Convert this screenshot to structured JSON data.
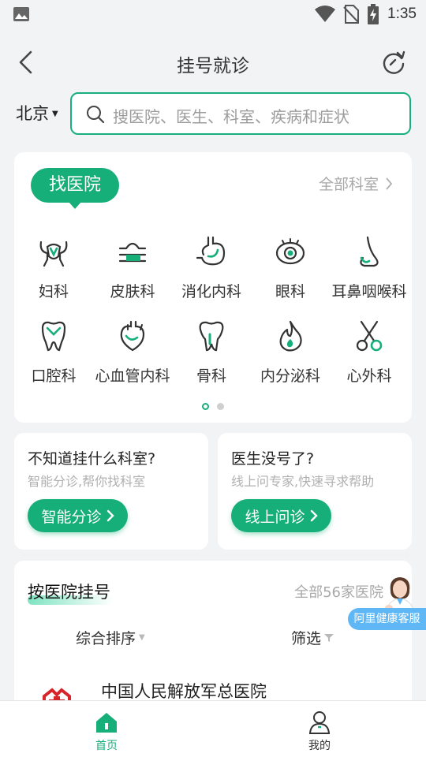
{
  "status_bar": {
    "time": "1:35"
  },
  "header": {
    "title": "挂号就诊"
  },
  "search": {
    "city": "北京",
    "placeholder": "搜医院、医生、科室、疾病和症状"
  },
  "find_hospital": {
    "pill_label": "找医院",
    "all_departments": "全部科室",
    "departments": [
      {
        "label": "妇科",
        "icon": "uterus-icon"
      },
      {
        "label": "皮肤科",
        "icon": "skin-icon"
      },
      {
        "label": "消化内科",
        "icon": "stomach-icon"
      },
      {
        "label": "眼科",
        "icon": "eye-icon"
      },
      {
        "label": "耳鼻咽喉科",
        "icon": "nose-icon"
      },
      {
        "label": "口腔科",
        "icon": "tooth-icon"
      },
      {
        "label": "心血管内科",
        "icon": "heart-icon"
      },
      {
        "label": "骨科",
        "icon": "bone-icon"
      },
      {
        "label": "内分泌科",
        "icon": "flame-icon"
      },
      {
        "label": "心外科",
        "icon": "scissors-icon"
      }
    ],
    "page_count": 2,
    "active_page": 1
  },
  "smart_triage": {
    "title": "不知道挂什么科室?",
    "subtitle": "智能分诊,帮你找科室",
    "button": "智能分诊"
  },
  "online_consult": {
    "title": "医生没号了?",
    "subtitle": "线上问专家,快速寻求帮助",
    "button": "线上问诊"
  },
  "by_hospital": {
    "title": "按医院挂号",
    "all_hospitals": "全部56家医院",
    "sort_label": "综合排序",
    "filter_label": "筛选",
    "first_hospital": "中国人民解放军总医院"
  },
  "service_bubble": "阿里健康客服",
  "bottom_nav": {
    "home": "首页",
    "mine": "我的"
  },
  "colors": {
    "brand_green": "#16ae79",
    "service_blue": "#5fb8f5"
  }
}
